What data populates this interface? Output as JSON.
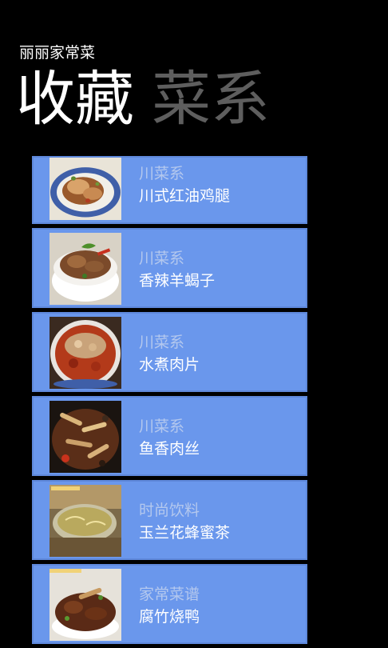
{
  "app": {
    "title": "丽丽家常菜"
  },
  "pivot": {
    "tabs": [
      {
        "label": "收藏",
        "active": true
      },
      {
        "label": "菜系",
        "active": false
      }
    ]
  },
  "favorites": [
    {
      "category": "川菜系",
      "name": "川式红油鸡腿"
    },
    {
      "category": "川菜系",
      "name": "香辣羊蝎子"
    },
    {
      "category": "川菜系",
      "name": "水煮肉片"
    },
    {
      "category": "川菜系",
      "name": "鱼香肉丝"
    },
    {
      "category": "时尚饮料",
      "name": "玉兰花蜂蜜茶"
    },
    {
      "category": "家常菜谱",
      "name": "腐竹烧鸭"
    }
  ],
  "colors": {
    "background": "#000000",
    "tile": "#6a97ec",
    "category_text": "#b4c8ee",
    "inactive_header": "#5e5e5e"
  }
}
